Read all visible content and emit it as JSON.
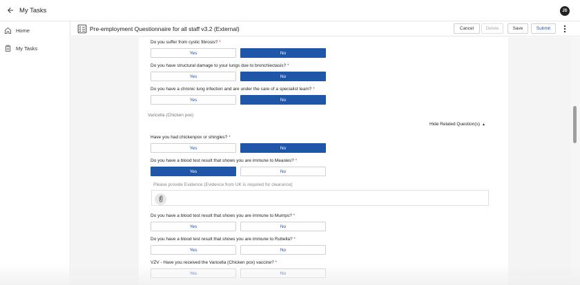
{
  "app": {
    "title": "My Tasks",
    "avatar_initials": "JS"
  },
  "sidebar": {
    "items": [
      {
        "label": "Home",
        "icon": "home-icon"
      },
      {
        "label": "My Tasks",
        "icon": "clipboard-icon"
      }
    ]
  },
  "header": {
    "form_title": "Pre-employment Questionnaire for all staff v3.2 (External)",
    "cancel_label": "Cancel",
    "delete_label": "Delete",
    "save_label": "Save",
    "submit_label": "Submit"
  },
  "options": {
    "yes": "Yes",
    "no": "No"
  },
  "questions": [
    {
      "text": "Do you suffer from cystic fibrosis?",
      "required": "*",
      "selected": "No"
    },
    {
      "text": "Do you have structural damage to your lungs due to bronchiectasis?",
      "required": "*",
      "selected": "No"
    },
    {
      "text": "Do you have a chronic lung infection and are under the care of a specialist team?",
      "required": "*",
      "selected": "No"
    },
    {
      "text": "Have you had chickenpox or shingles?",
      "required": "*",
      "selected": "No"
    },
    {
      "text": "Do you have a blood test result that shows you are immune to Measles?",
      "required": "*",
      "selected": "Yes"
    },
    {
      "text": "Do you have a blood test result that shows you are immune to Mumps?",
      "required": "*",
      "selected": ""
    },
    {
      "text": "Do you have a blood test result that shows you are immune to Rubella?",
      "required": "*",
      "selected": ""
    },
    {
      "text": "VZV - Have you received the Varicella (Chicken pox) vaccine?",
      "required": "*",
      "selected": ""
    }
  ],
  "section": {
    "label": "Varicella (Chicken pox)",
    "hide_related": "Hide Related Question(s)"
  },
  "evidence": {
    "label": "Please provide Evidence (Evidence from UK is required for clearance)"
  },
  "colors": {
    "primary": "#1f56a8",
    "required": "#c0392b"
  }
}
